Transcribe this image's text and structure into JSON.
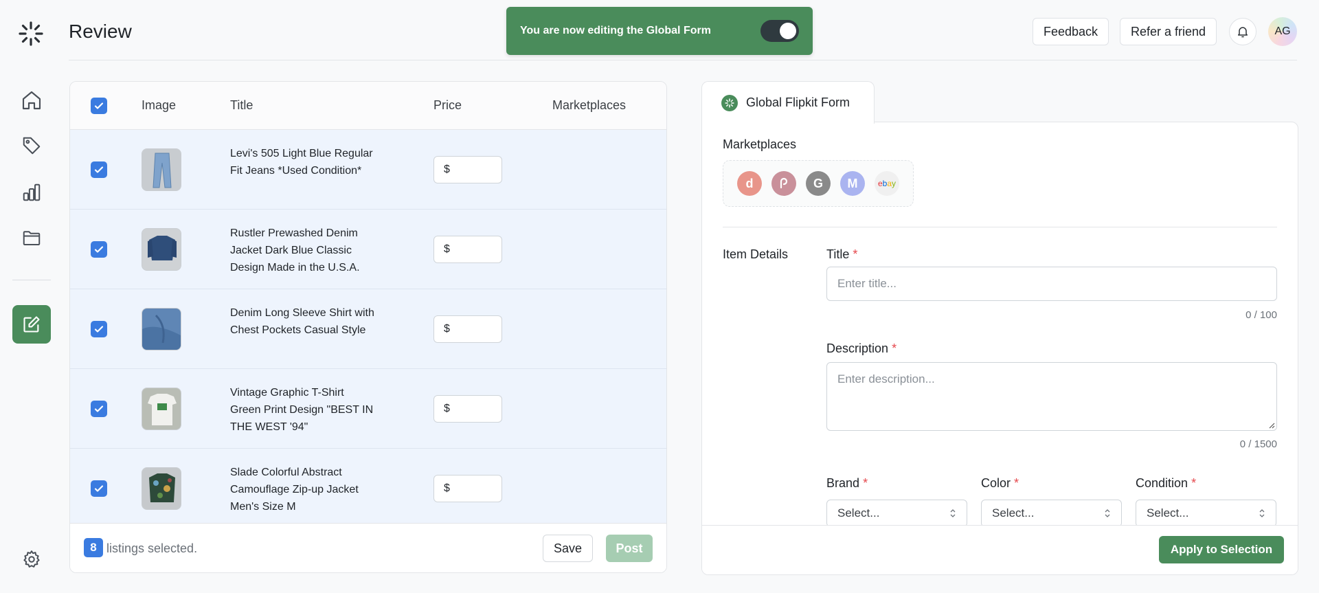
{
  "header": {
    "title": "Review",
    "toast_text": "You are now editing the Global Form",
    "feedback_label": "Feedback",
    "refer_label": "Refer a friend",
    "avatar_initials": "AG"
  },
  "sidebar": {
    "items": [
      {
        "icon": "home-icon"
      },
      {
        "icon": "tag-icon"
      },
      {
        "icon": "bar-chart-icon"
      },
      {
        "icon": "folder-icon"
      },
      {
        "icon": "edit-icon",
        "active": true
      }
    ],
    "settings_icon": "gear-icon"
  },
  "table": {
    "columns": [
      "Image",
      "Title",
      "Price",
      "Marketplaces"
    ],
    "rows": [
      {
        "title": "Levi's 505 Light Blue Regular Fit Jeans *Used Condition*",
        "currency": "$",
        "price": ""
      },
      {
        "title": "Rustler Prewashed Denim Jacket Dark Blue Classic Design Made in the U.S.A.",
        "currency": "$",
        "price": ""
      },
      {
        "title": "Denim Long Sleeve Shirt with Chest Pockets Casual Style",
        "currency": "$",
        "price": ""
      },
      {
        "title": "Vintage Graphic T-Shirt Green Print Design \"BEST IN THE WEST '94\"",
        "currency": "$",
        "price": ""
      },
      {
        "title": "Slade Colorful Abstract Camouflage Zip-up Jacket Men's Size M",
        "currency": "$",
        "price": ""
      }
    ],
    "selected_count": "8",
    "selected_text": "listings selected.",
    "save_label": "Save",
    "post_label": "Post"
  },
  "form": {
    "tab_label": "Global Flipkit Form",
    "marketplaces_label": "Marketplaces",
    "marketplaces": [
      {
        "name": "depop",
        "glyph": "d",
        "color": "#e8958a"
      },
      {
        "name": "poshmark",
        "glyph": "P",
        "color": "#c9909a"
      },
      {
        "name": "grailed",
        "glyph": "G",
        "color": "#8a8a8a"
      },
      {
        "name": "mercari",
        "glyph": "M",
        "color": "#aab4f0"
      },
      {
        "name": "ebay",
        "glyph": "ebay",
        "color": "#f0f0f0"
      }
    ],
    "item_details_label": "Item Details",
    "title_label": "Title",
    "title_placeholder": "Enter title...",
    "title_counter": "0 / 100",
    "description_label": "Description",
    "description_placeholder": "Enter description...",
    "description_counter": "0 / 1500",
    "brand_label": "Brand",
    "color_label": "Color",
    "condition_label": "Condition",
    "select_placeholder": "Select...",
    "required_mark": "*",
    "apply_label": "Apply to Selection"
  }
}
